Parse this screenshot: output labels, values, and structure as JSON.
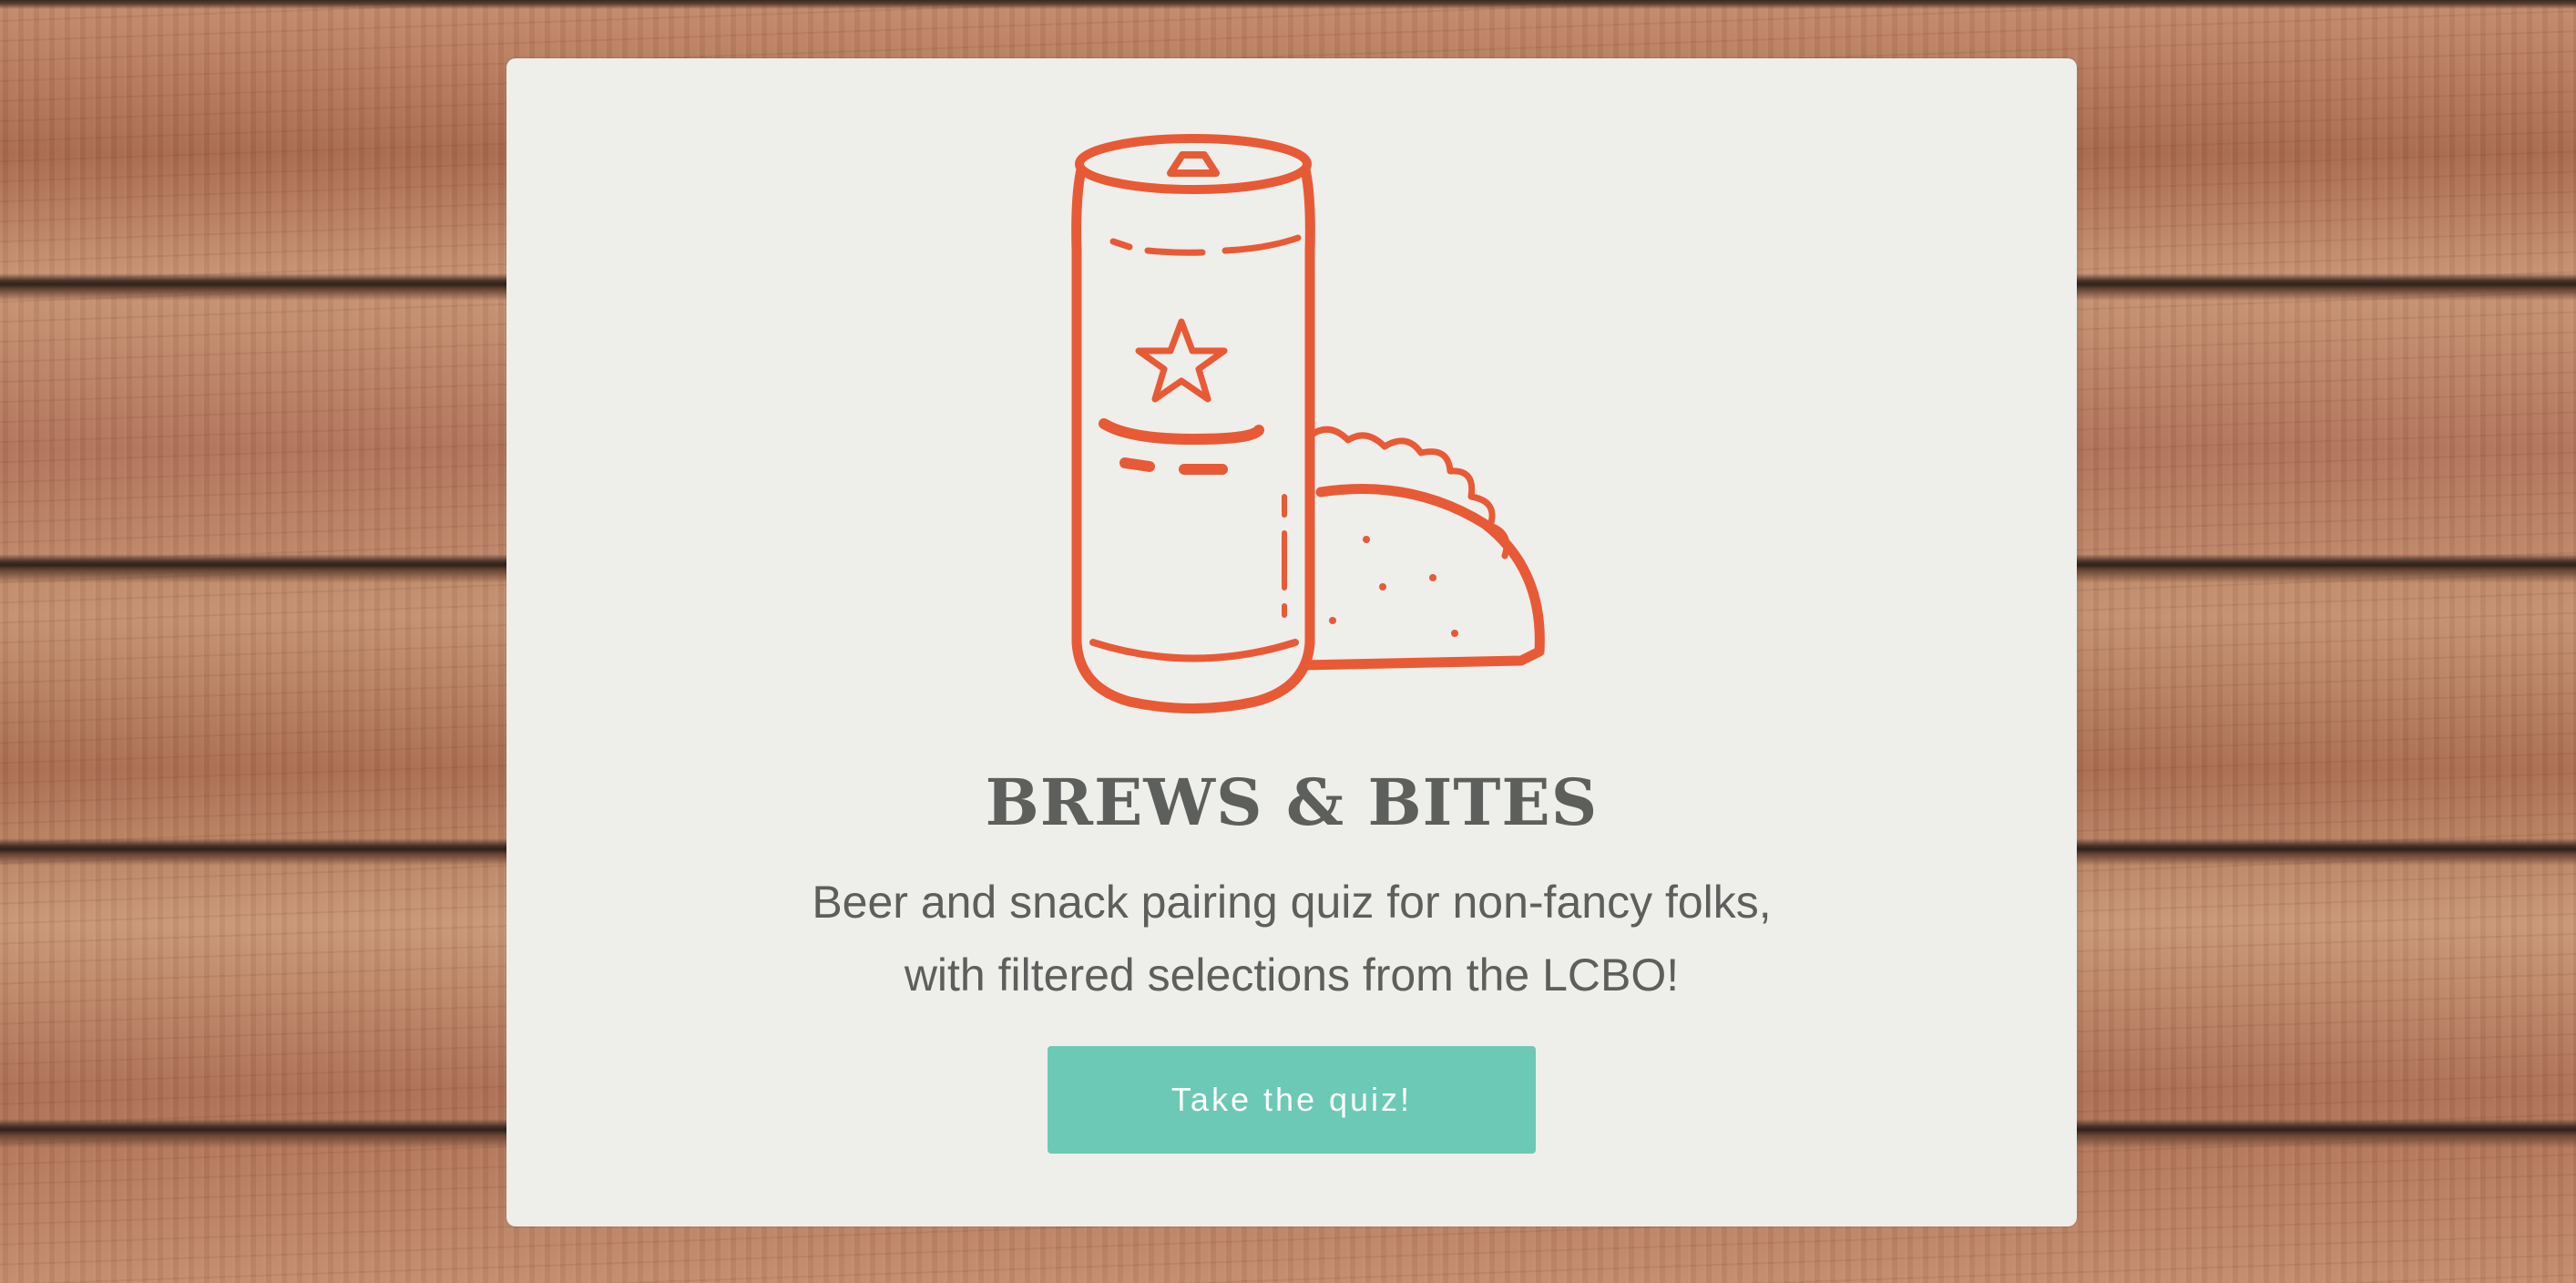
{
  "app": {
    "title": "BREWS & BITES",
    "tagline_line1": "Beer and snack pairing quiz for non-fancy folks,",
    "tagline_line2": "with filtered selections from the LCBO!",
    "cta_label": "Take the quiz!"
  },
  "icons": {
    "hero": "beer-can-and-taco-icon"
  },
  "colors": {
    "accent": "#e85a35",
    "button": "#6cc9b5",
    "card_background": "#eeeeeb",
    "text": "#5d5f5d"
  }
}
